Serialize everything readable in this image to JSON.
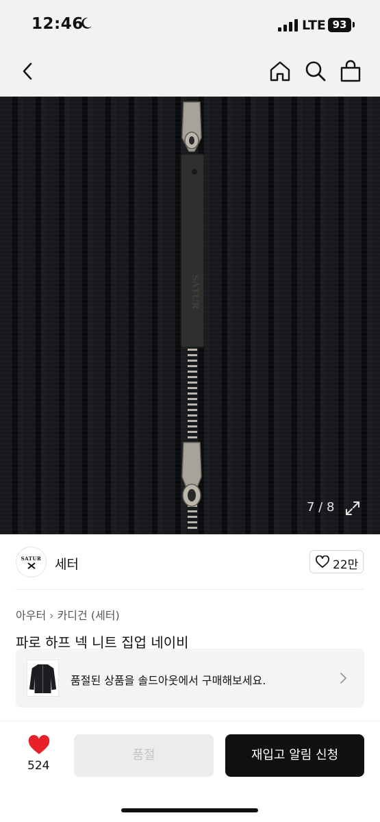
{
  "status_bar": {
    "time": "12:46",
    "network": "LTE",
    "battery": "93"
  },
  "nav": {
    "back_icon": "chevron-left-icon",
    "home_icon": "home-icon",
    "search_icon": "search-icon",
    "bag_icon": "shopping-bag-icon"
  },
  "gallery": {
    "counter": "7 / 8",
    "current": 7,
    "total": 8,
    "zipper_tag_text": "SATUR",
    "expand_icon": "expand-icon"
  },
  "brand": {
    "logo_text": "SATUR",
    "name": "세터",
    "like_count": "22만"
  },
  "product": {
    "category": "아우터",
    "subcategory": "카디건 (세터)",
    "title": "파로 하프 넥 니트 집업 네이비"
  },
  "soldout_banner": {
    "text": "품절된 상품을 솔드아웃에서 구매해보세요."
  },
  "bottom_bar": {
    "wishlist_count": "524",
    "soldout_label": "품절",
    "restock_label": "재입고 알림 신청",
    "heart_color": "#e8202a"
  }
}
